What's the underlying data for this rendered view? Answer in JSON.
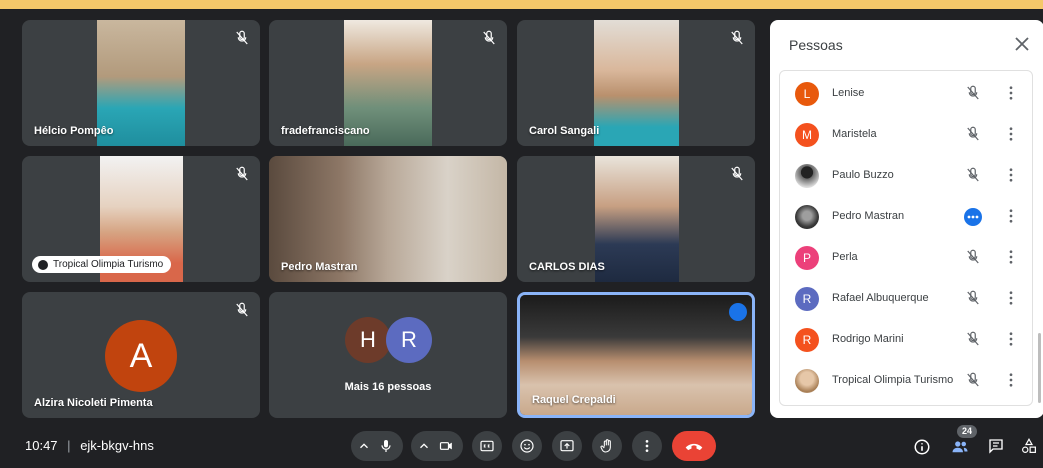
{
  "meeting": {
    "time": "10:47",
    "separator": "|",
    "code": "ejk-bkgv-hns"
  },
  "tiles": [
    {
      "name": "Hélcio Pompêo",
      "muted": true
    },
    {
      "name": "fradefranciscano",
      "muted": true
    },
    {
      "name": "Carol Sangali",
      "muted": true
    },
    {
      "name": "Tropical Olimpia Turismo",
      "muted": true,
      "label_style": "pill"
    },
    {
      "name": "Pedro Mastran",
      "muted": false
    },
    {
      "name": "CARLOS DIAS",
      "muted": true
    },
    {
      "name": "Alzira Nicoleti Pimenta",
      "muted": true,
      "avatar_letter": "A",
      "avatar_color": "#c1440e"
    },
    {
      "name": "Mais 16 pessoas",
      "avatars": [
        {
          "letter": "H",
          "color": "#6d3b2a"
        },
        {
          "letter": "R",
          "color": "#5c6bc0"
        }
      ]
    },
    {
      "name": "Raquel Crepaldi",
      "muted": false,
      "highlighted": true,
      "highlight_color": "#8ab4f8"
    }
  ],
  "panel": {
    "title": "Pessoas",
    "participants": [
      {
        "name": "Lenise",
        "initial": "L",
        "color": "#e8590c",
        "status": "muted"
      },
      {
        "name": "Maristela",
        "initial": "M",
        "color": "#f4511e",
        "status": "muted"
      },
      {
        "name": "Paulo Buzzo",
        "initial": "",
        "color": "#424242",
        "status": "muted"
      },
      {
        "name": "Pedro Mastran",
        "initial": "",
        "color": "#5f6368",
        "status": "speaking"
      },
      {
        "name": "Perla",
        "initial": "P",
        "color": "#ec407a",
        "status": "muted"
      },
      {
        "name": "Rafael Albuquerque",
        "initial": "R",
        "color": "#5c6bc0",
        "status": "muted"
      },
      {
        "name": "Rodrigo Marini",
        "initial": "R",
        "color": "#f4511e",
        "status": "muted"
      },
      {
        "name": "Tropical Olimpia Turismo",
        "initial": "",
        "color": "#d7b59a",
        "status": "muted"
      }
    ]
  },
  "controls": {
    "people_count": "24",
    "icons": [
      "chevron-up-icon",
      "mic-icon",
      "chevron-up-icon",
      "camera-icon",
      "captions-icon",
      "emoji-icon",
      "present-icon",
      "raise-hand-icon",
      "more-options-icon",
      "end-call-icon",
      "info-icon",
      "people-icon",
      "chat-icon",
      "activities-icon"
    ]
  }
}
